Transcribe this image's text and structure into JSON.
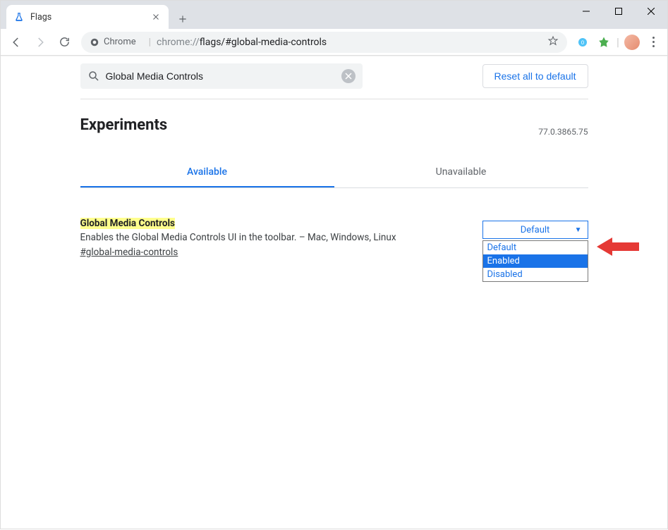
{
  "window": {
    "tab_title": "Flags"
  },
  "toolbar": {
    "secure_label": "Chrome",
    "url_prefix": "chrome://",
    "url_path": "flags/#global-media-controls"
  },
  "page": {
    "search_value": "Global Media Controls",
    "reset_label": "Reset all to default",
    "title": "Experiments",
    "version": "77.0.3865.75",
    "tabs": {
      "available": "Available",
      "unavailable": "Unavailable"
    },
    "flag": {
      "title": "Global Media Controls",
      "desc": "Enables the Global Media Controls UI in the toolbar. – Mac, Windows, Linux",
      "anchor": "#global-media-controls",
      "selected": "Default",
      "options": [
        "Default",
        "Enabled",
        "Disabled"
      ],
      "highlighted_option_index": 1
    }
  }
}
